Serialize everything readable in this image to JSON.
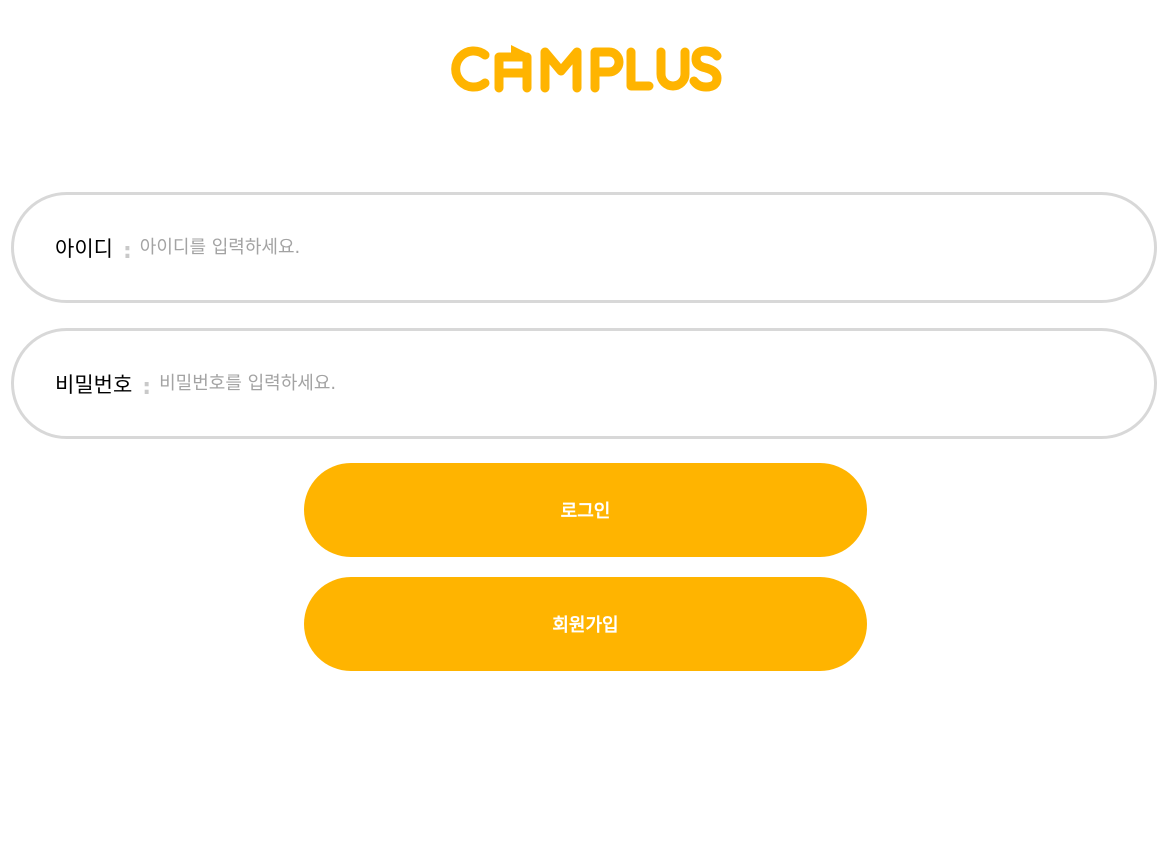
{
  "brand": {
    "name": "CAMPLUS",
    "color": "#ffb400"
  },
  "login_form": {
    "id_field": {
      "label": "아이디",
      "separator": ":",
      "placeholder": "아이디를 입력하세요.",
      "value": ""
    },
    "password_field": {
      "label": "비밀번호",
      "separator": ":",
      "placeholder": "비밀번호를 입력하세요.",
      "value": ""
    },
    "login_button_label": "로그인",
    "signup_button_label": "회원가입"
  },
  "colors": {
    "accent": "#ffb400",
    "field_border": "#d8d8d8",
    "placeholder": "#a3a3a3",
    "separator": "#c9c9c9"
  }
}
